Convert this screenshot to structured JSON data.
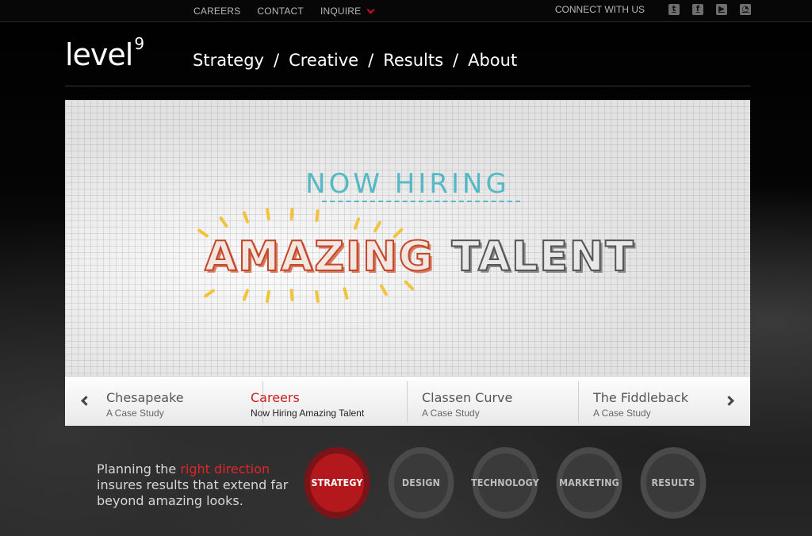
{
  "topbar": {
    "links": [
      {
        "label": "CAREERS"
      },
      {
        "label": "CONTACT"
      },
      {
        "label": "INQUIRE"
      }
    ],
    "connect_label": "CONNECT WITH US",
    "social": [
      {
        "icon": "twitter-icon",
        "glyph": "t"
      },
      {
        "icon": "facebook-icon",
        "glyph": "f"
      },
      {
        "icon": "youtube-icon",
        "glyph": "▶"
      },
      {
        "icon": "rss-icon",
        "glyph": "◔"
      }
    ]
  },
  "logo": {
    "text": "level",
    "sup": "9"
  },
  "nav": {
    "items": [
      {
        "label": "Strategy"
      },
      {
        "label": "Creative"
      },
      {
        "label": "Results"
      },
      {
        "label": "About"
      }
    ],
    "separator": "/"
  },
  "hero": {
    "headline": "NOW HIRING",
    "word1": "AMAZING",
    "word2": "TALENT"
  },
  "slider": {
    "slides": [
      {
        "title": "Chesapeake",
        "subtitle": "A Case Study"
      },
      {
        "title": "Careers",
        "subtitle": "Now Hiring Amazing Talent",
        "active": true
      },
      {
        "title": "Classen Curve",
        "subtitle": "A Case Study"
      },
      {
        "title": "The Fiddleback",
        "subtitle": "A Case Study"
      }
    ]
  },
  "tagline": {
    "before": "Planning the ",
    "highlight": "right direction",
    "after": " insures results that extend far beyond amazing looks."
  },
  "services": [
    {
      "label": "STRATEGY",
      "active": true
    },
    {
      "label": "DESIGN"
    },
    {
      "label": "TECHNOLOGY"
    },
    {
      "label": "MARKETING"
    },
    {
      "label": "RESULTS"
    }
  ],
  "colors": {
    "accent": "#d0141c",
    "hiring": "#55b8c4",
    "amazing": "#c5472a"
  }
}
